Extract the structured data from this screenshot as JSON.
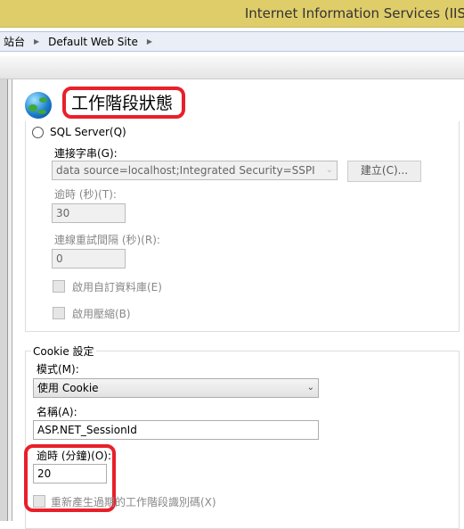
{
  "window": {
    "title": "Internet Information Services (IIS"
  },
  "breadcrumb": {
    "items": [
      "站台",
      "Default Web Site"
    ]
  },
  "page": {
    "title": "工作階段狀態",
    "icon": "globe-icon"
  },
  "sql": {
    "radio_label": "SQL Server(Q)",
    "conn_label": "連接字串(G):",
    "conn_value": "data source=localhost;Integrated Security=SSPI",
    "create_button": "建立(C)...",
    "timeout_label": "逾時 (秒)(T):",
    "timeout_value": "30",
    "retry_label": "連線重試間隔 (秒)(R):",
    "retry_value": "0",
    "custom_db_label": "啟用自訂資料庫(E)",
    "compression_label": "啟用壓縮(B)"
  },
  "cookie": {
    "legend": "Cookie 設定",
    "mode_label": "模式(M):",
    "mode_value": "使用 Cookie",
    "name_label": "名稱(A):",
    "name_value": "ASP.NET_SessionId",
    "timeout_label": "逾時 (分鐘)(O):",
    "timeout_value": "20",
    "regen_label": "重新產生過期的工作階段識別碼(X)"
  },
  "colors": {
    "highlight": "#e8202a",
    "titlebar": "#dfcd6a"
  }
}
